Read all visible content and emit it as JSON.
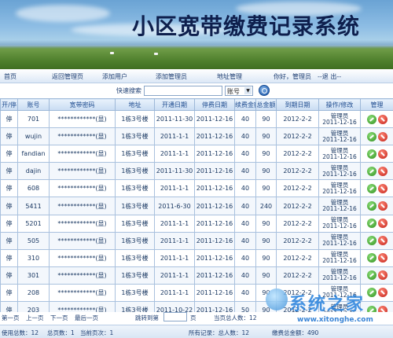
{
  "banner": {
    "title": "小区宽带缴费记录系统"
  },
  "nav": {
    "home": "首页",
    "back_admin": "返回管理页",
    "add_user": "添加用户",
    "add_admin": "添加管理员",
    "address_admin": "地址管理",
    "greeting": "你好，管理员",
    "logout": "--退 出--"
  },
  "search": {
    "label": "快速搜索",
    "input_value": "",
    "select_value": "账号",
    "select_arrow": "▼"
  },
  "table": {
    "headers": [
      "开/停",
      "账号",
      "宽带密码",
      "地址",
      "开通日期",
      "停费日期",
      "续费金额",
      "总金额",
      "到期日期",
      "操作/修改",
      "管理"
    ],
    "rows": [
      {
        "status": "停",
        "account": "701",
        "password": "************(显)",
        "address": "1栋3号楼",
        "open": "2011-11-30",
        "stop": "2011-12-16",
        "renew": "40",
        "total": "90",
        "expire": "2012-2-2",
        "op_user": "管理员",
        "op_date": "2011-12-16"
      },
      {
        "status": "停",
        "account": "wujin",
        "password": "************(显)",
        "address": "1栋3号楼",
        "open": "2011-1-1",
        "stop": "2011-12-16",
        "renew": "40",
        "total": "90",
        "expire": "2012-2-2",
        "op_user": "管理员",
        "op_date": "2011-12-16"
      },
      {
        "status": "停",
        "account": "fandian",
        "password": "************(显)",
        "address": "1栋3号楼",
        "open": "2011-1-1",
        "stop": "2011-12-16",
        "renew": "40",
        "total": "90",
        "expire": "2012-2-2",
        "op_user": "管理员",
        "op_date": "2011-12-16"
      },
      {
        "status": "停",
        "account": "dajin",
        "password": "************(显)",
        "address": "1栋3号楼",
        "open": "2011-11-30",
        "stop": "2011-12-16",
        "renew": "40",
        "total": "90",
        "expire": "2012-2-2",
        "op_user": "管理员",
        "op_date": "2011-12-16"
      },
      {
        "status": "停",
        "account": "608",
        "password": "************(显)",
        "address": "1栋3号楼",
        "open": "2011-1-1",
        "stop": "2011-12-16",
        "renew": "40",
        "total": "90",
        "expire": "2012-2-2",
        "op_user": "管理员",
        "op_date": "2011-12-16"
      },
      {
        "status": "停",
        "account": "5411",
        "password": "************(显)",
        "address": "1栋3号楼",
        "open": "2011-6-30",
        "stop": "2011-12-16",
        "renew": "40",
        "total": "240",
        "expire": "2012-2-2",
        "op_user": "管理员",
        "op_date": "2011-12-16"
      },
      {
        "status": "停",
        "account": "5201",
        "password": "************(显)",
        "address": "1栋3号楼",
        "open": "2011-1-1",
        "stop": "2011-12-16",
        "renew": "40",
        "total": "90",
        "expire": "2012-2-2",
        "op_user": "管理员",
        "op_date": "2011-12-16"
      },
      {
        "status": "停",
        "account": "505",
        "password": "************(显)",
        "address": "1栋3号楼",
        "open": "2011-1-1",
        "stop": "2011-12-16",
        "renew": "40",
        "total": "90",
        "expire": "2012-2-2",
        "op_user": "管理员",
        "op_date": "2011-12-16"
      },
      {
        "status": "停",
        "account": "310",
        "password": "************(显)",
        "address": "1栋3号楼",
        "open": "2011-1-1",
        "stop": "2011-12-16",
        "renew": "40",
        "total": "90",
        "expire": "2012-2-2",
        "op_user": "管理员",
        "op_date": "2011-12-16"
      },
      {
        "status": "停",
        "account": "301",
        "password": "************(显)",
        "address": "1栋3号楼",
        "open": "2011-1-1",
        "stop": "2011-12-16",
        "renew": "40",
        "total": "90",
        "expire": "2012-2-2",
        "op_user": "管理员",
        "op_date": "2011-12-16"
      },
      {
        "status": "停",
        "account": "208",
        "password": "************(显)",
        "address": "1栋3号楼",
        "open": "2011-1-1",
        "stop": "2011-12-16",
        "renew": "40",
        "total": "90",
        "expire": "2012-2-2",
        "op_user": "管理员",
        "op_date": "2011-12-16"
      },
      {
        "status": "停",
        "account": "203",
        "password": "************(显)",
        "address": "1栋3号楼",
        "open": "2011-10-22",
        "stop": "2011-12-16",
        "renew": "50",
        "total": "90",
        "expire": "2012-2-2",
        "op_user": "管理员",
        "op_date": "2011-12-16"
      }
    ]
  },
  "pager": {
    "first": "第一页",
    "prev": "上一页",
    "next": "下一页",
    "last": "最后一页",
    "jump_label": "跳转到第",
    "jump_suffix": "页",
    "current_total": "当页总人数：12"
  },
  "status_bar": {
    "used_total": "使用总数：12",
    "total_pages": "总页数：1",
    "current_page": "当前页次：1",
    "all_records": "所有记录：总人数：12",
    "paid_total": "缴费总金额：490"
  },
  "watermark": {
    "text": "系统之家",
    "url": "www.xitonghe.com"
  },
  "colors": {
    "header_text": "#1d4b8f",
    "title_text": "#0e1f4d",
    "edit_icon": "#2f8d1c",
    "delete_icon": "#c21c12"
  }
}
